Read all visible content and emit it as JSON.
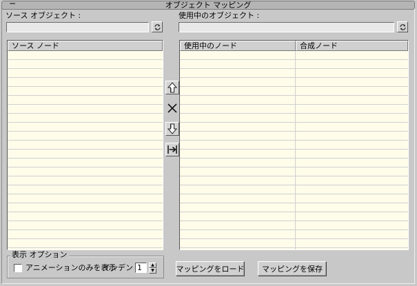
{
  "rollout": {
    "collapse_glyph": "−",
    "title": "オブジェクト マッピング"
  },
  "source_object": {
    "label": "ソース オブジェクト :",
    "value": "",
    "pick_icon": "pick-refresh-icon"
  },
  "target_object": {
    "label": "使用中のオブジェクト :",
    "value": "",
    "pick_icon": "pick-refresh-icon"
  },
  "source_list": {
    "columns": [
      "ソース ノード"
    ],
    "rows": []
  },
  "target_list": {
    "columns": [
      "使用中のノード",
      "合成ノード"
    ],
    "rows": []
  },
  "mapping_tools": [
    {
      "name": "move-up-button",
      "icon": "arrow-up-icon"
    },
    {
      "name": "delete-button",
      "icon": "x-icon"
    },
    {
      "name": "move-down-button",
      "icon": "arrow-down-icon"
    },
    {
      "name": "map-right-button",
      "icon": "map-arrow-right-icon"
    }
  ],
  "display_options": {
    "group_label": "表示 オプション",
    "animation_only_label": "アニメーションのみを表示",
    "animation_only_checked": false,
    "indent_label": "インデント :",
    "indent_value": "1"
  },
  "buttons": {
    "load_mapping": "マッピングをロード",
    "save_mapping": "マッピングを保存"
  }
}
